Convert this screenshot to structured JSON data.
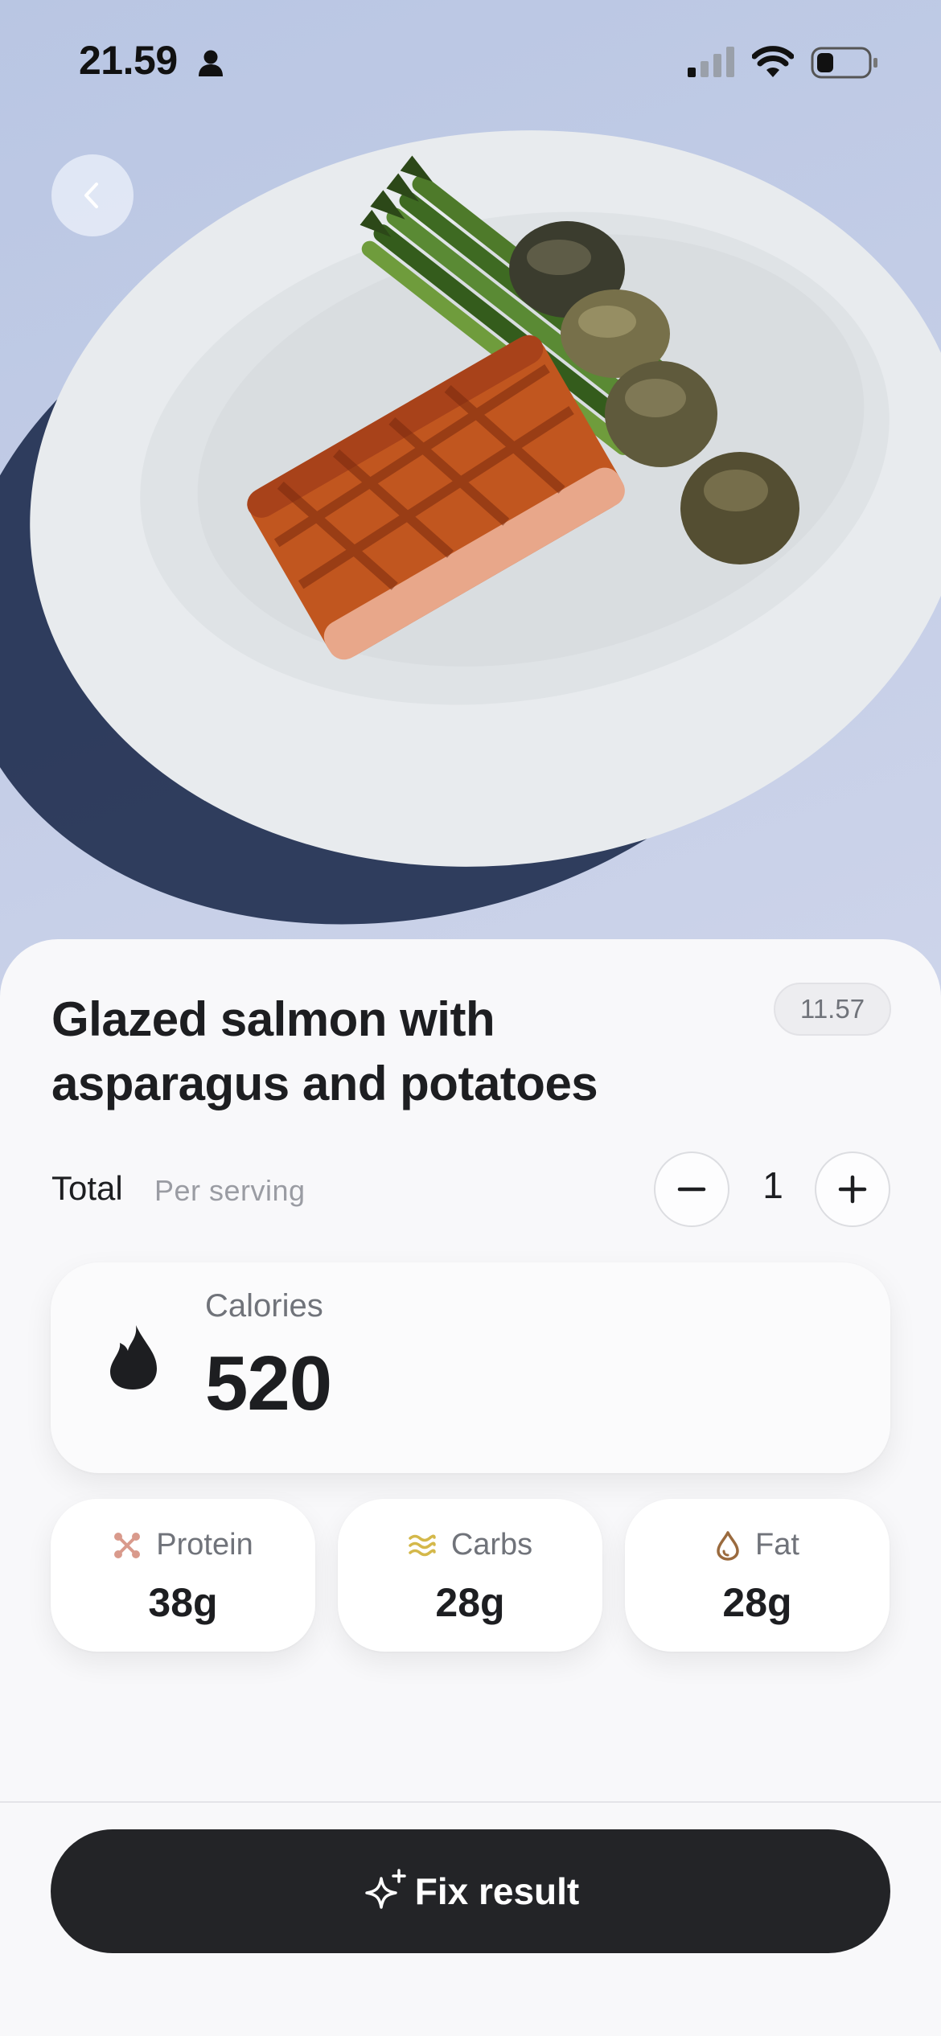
{
  "status_bar": {
    "time": "21.59",
    "icons": [
      "person-icon",
      "cellular-signal-icon",
      "wifi-icon",
      "battery-icon"
    ]
  },
  "header": {
    "back_icon": "chevron-left-icon"
  },
  "hero_image": {
    "description_icon": "food-photo"
  },
  "meal": {
    "title": "Glazed salmon with asparagus and potatoes",
    "time": "11.57"
  },
  "serving": {
    "total_label": "Total",
    "per_serving_label": "Per serving",
    "quantity": "1",
    "minus_icon": "minus-icon",
    "plus_icon": "plus-icon"
  },
  "calories": {
    "label": "Calories",
    "value": "520",
    "icon": "flame-icon"
  },
  "macros": [
    {
      "name": "Protein",
      "value": "38g",
      "icon": "protein-icon",
      "color": "#d99a8c"
    },
    {
      "name": "Carbs",
      "value": "28g",
      "icon": "carbs-icon",
      "color": "#d4b84a"
    },
    {
      "name": "Fat",
      "value": "28g",
      "icon": "fat-drop-icon",
      "color": "#9a6a3e"
    }
  ],
  "actions": {
    "fix_result_label": "Fix result",
    "fix_icon": "sparkle-icon"
  }
}
